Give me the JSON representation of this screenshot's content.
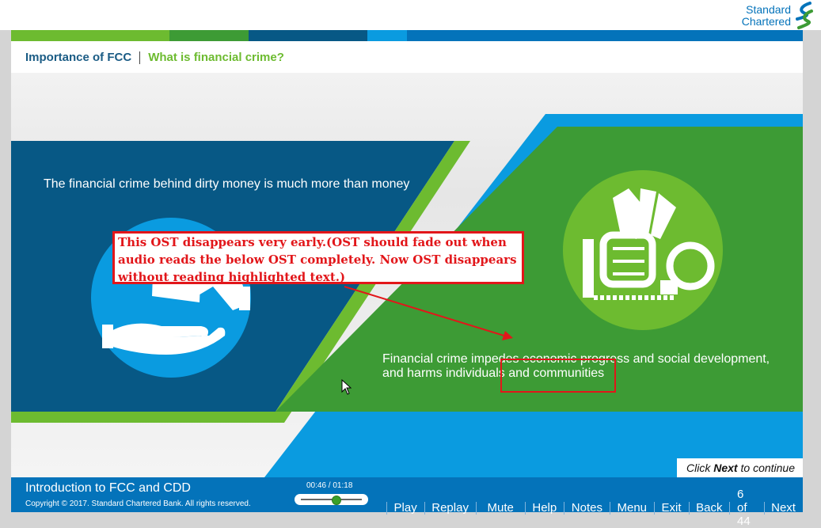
{
  "brand": {
    "line1": "Standard",
    "line2": "Chartered"
  },
  "breadcrumb": {
    "section": "Importance of FCC",
    "title": "What is financial crime?"
  },
  "slide": {
    "caption_left": "The financial crime behind dirty money is much more than money",
    "caption_right": "Financial crime impedes economic progress and social development, and harms individuals and communities",
    "continue_pre": "Click ",
    "continue_bold": "Next",
    "continue_post": " to continue"
  },
  "review_note": "This OST disappears very early.(OST should fade out when audio reads the below OST completely. Now OST disappears without reading highlighted text.)",
  "footer": {
    "course_title": "Introduction to FCC and CDD",
    "copyright": "Copyright © 2017. Standard Chartered Bank. All rights reserved.",
    "timecode": "00:46 / 01:18",
    "progress": 0.59,
    "controls": {
      "play": "Play",
      "replay": "Replay",
      "mute": "Mute",
      "help": "Help",
      "notes": "Notes",
      "menu": "Menu",
      "exit": "Exit",
      "back": "Back",
      "page": "6 of 44",
      "next": "Next"
    }
  },
  "colors": {
    "brand_blue": "#0473ba",
    "dark_blue": "#075885",
    "green": "#3d9b35",
    "light_green": "#6dbb30",
    "light_blue": "#0a9be0",
    "note_red": "#e2161a"
  },
  "icons": [
    "standard-chartered-logo-icon",
    "money-hand-icon",
    "fist-money-handcuff-icon",
    "mouse-pointer-icon"
  ]
}
